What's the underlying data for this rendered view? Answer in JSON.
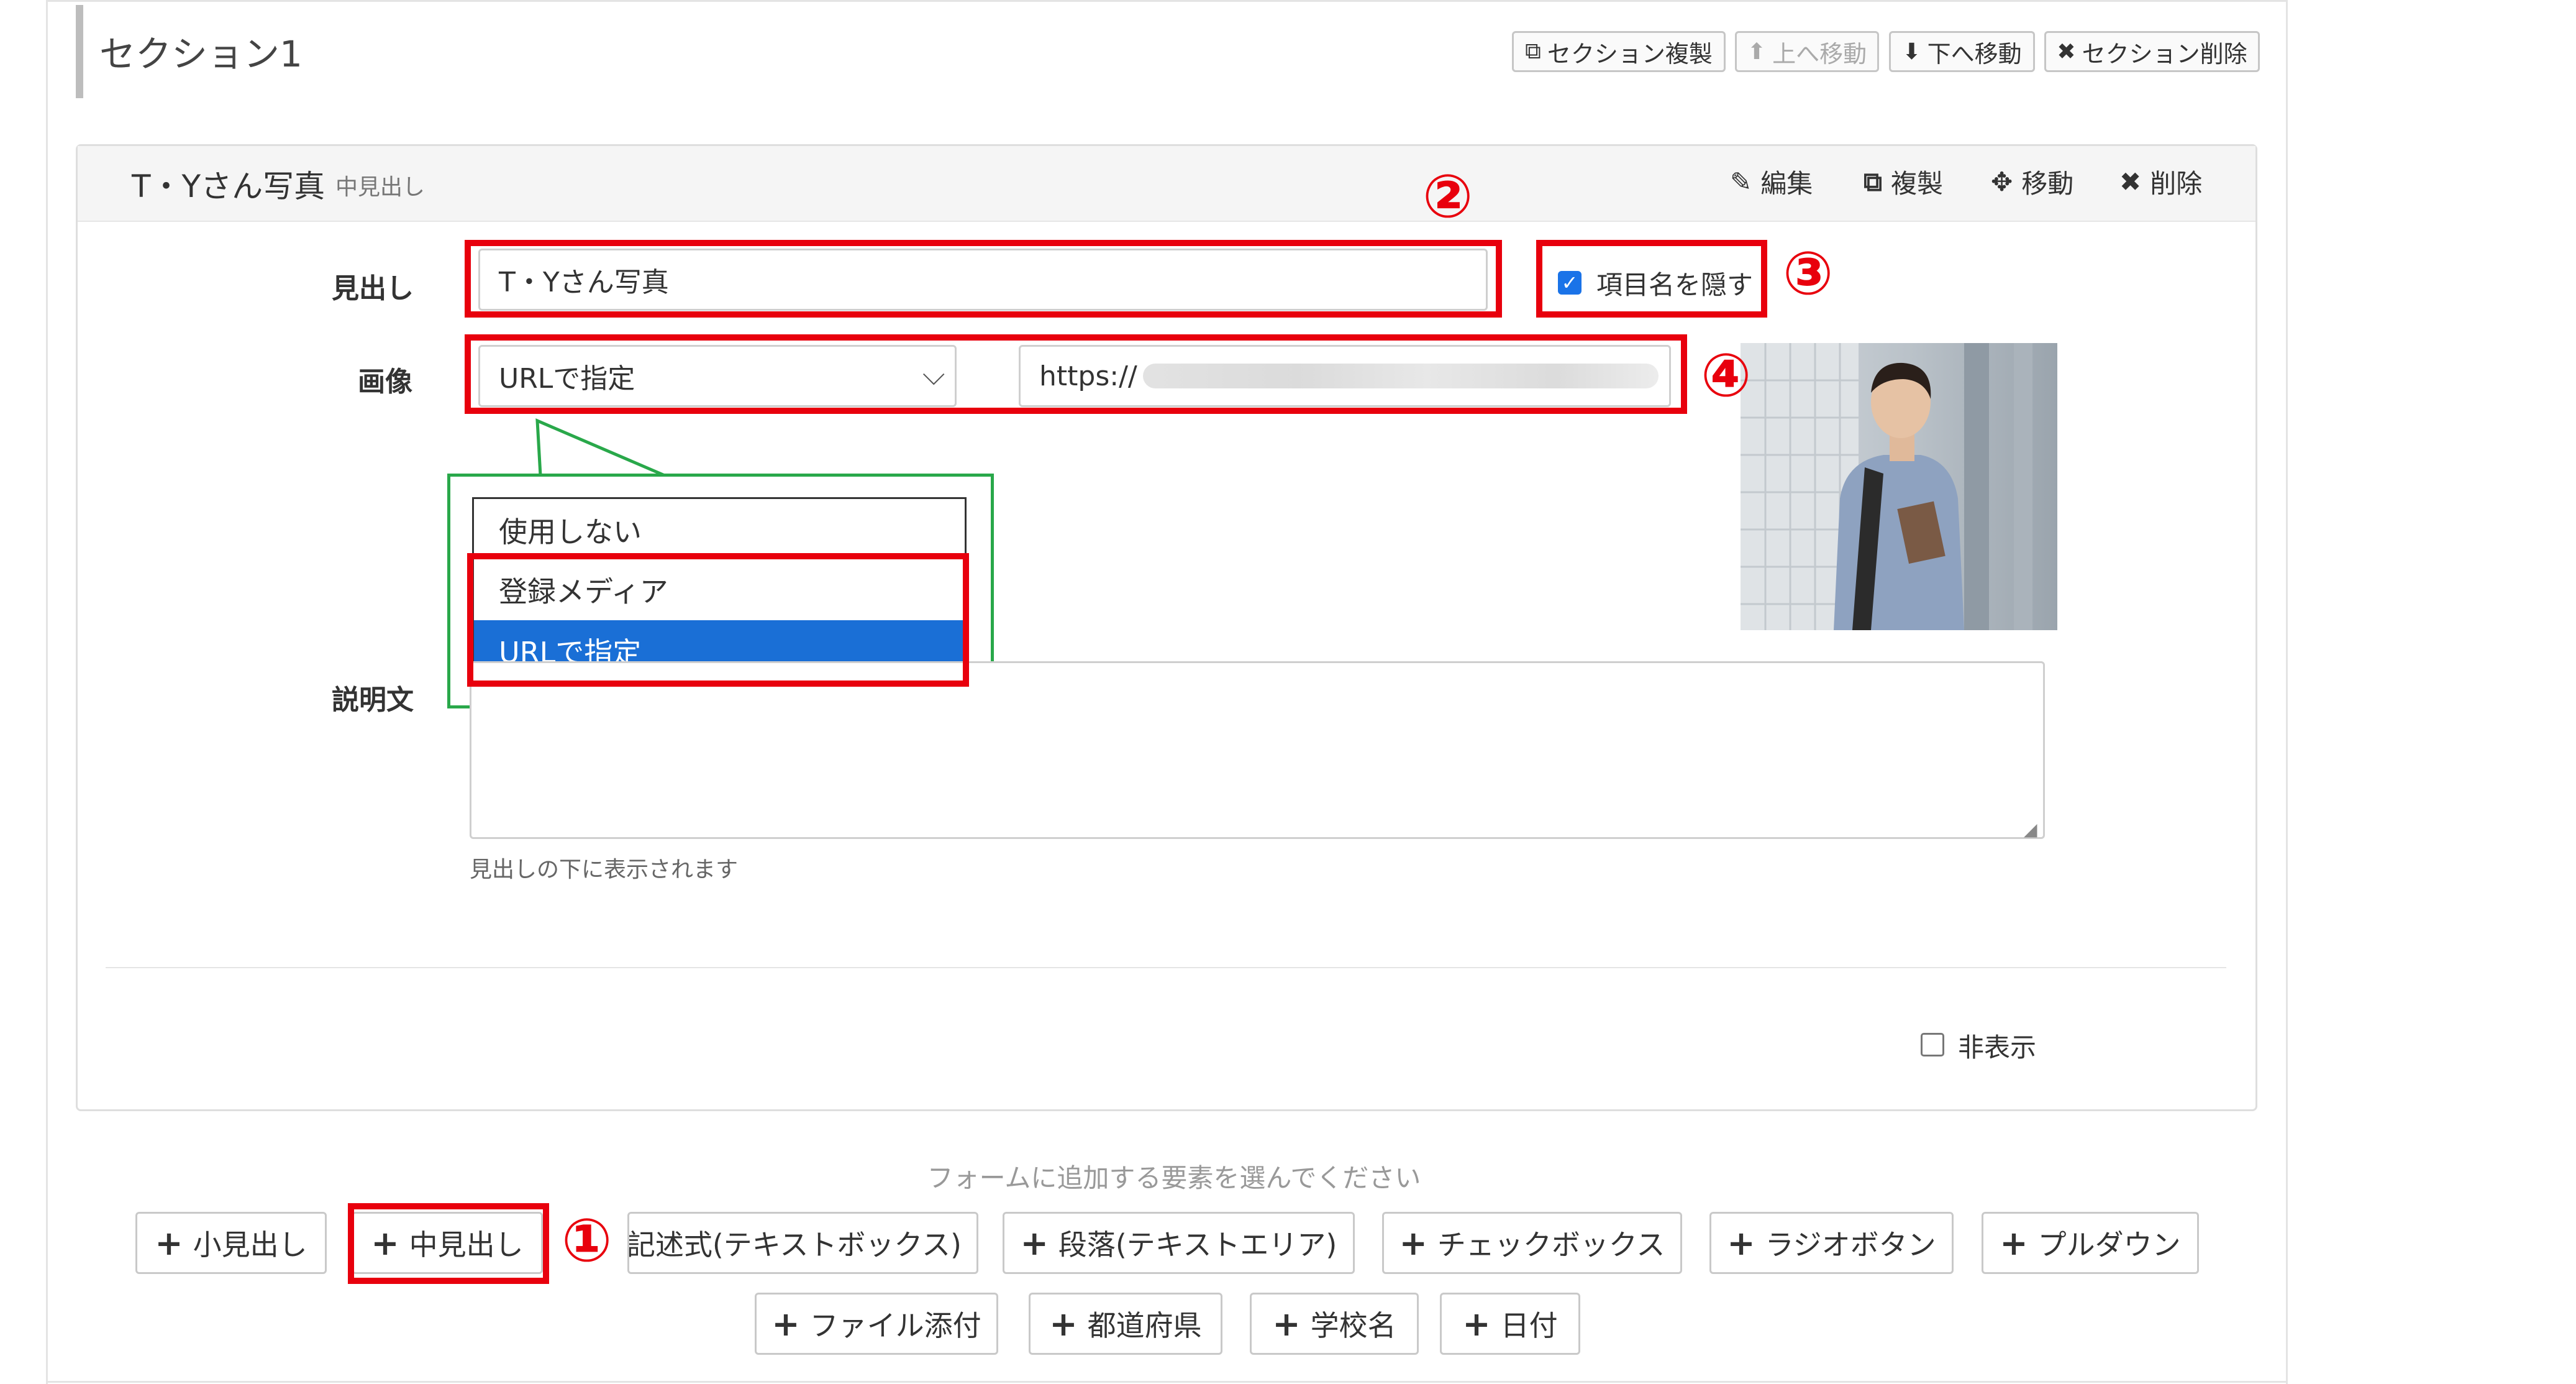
{
  "section": {
    "title": "セクション1",
    "buttons": [
      {
        "label": "セクション複製",
        "icon": "duplicate-icon",
        "disabled": false
      },
      {
        "label": "上へ移動",
        "icon": "arrow-up-icon",
        "disabled": true
      },
      {
        "label": "下へ移動",
        "icon": "arrow-down-icon",
        "disabled": false
      },
      {
        "label": "セクション削除",
        "icon": "close-icon",
        "disabled": false
      }
    ]
  },
  "field": {
    "name": "T・Yさん写真",
    "type": "中見出し",
    "actions": [
      {
        "label": "編集",
        "icon": "pencil-icon"
      },
      {
        "label": "複製",
        "icon": "duplicate-icon"
      },
      {
        "label": "移動",
        "icon": "move-icon"
      },
      {
        "label": "削除",
        "icon": "close-icon"
      }
    ],
    "heading_label": "見出し",
    "heading_value": "T・Yさん写真",
    "hide_name_label": "項目名を隠す",
    "hide_name_checked": true,
    "image_label": "画像",
    "image_select_value": "URLで指定",
    "image_url_value": "https://",
    "description_label": "説明文",
    "description_help": "見出しの下に表示されます",
    "hide_field_label": "非表示",
    "hide_field_checked": false
  },
  "dropdown_options": [
    {
      "label": "使用しない",
      "selected": false
    },
    {
      "label": "登録メディア",
      "selected": false
    },
    {
      "label": "URLで指定",
      "selected": true
    }
  ],
  "annotations": {
    "n1": "①",
    "n2": "②",
    "n3": "③",
    "n4": "④",
    "highlight_color": "#e8000d",
    "callout_color": "#29a84a"
  },
  "add_element": {
    "prompt": "フォームに追加する要素を選んでください",
    "buttons": [
      "小見出し",
      "中見出し",
      "記述式(テキストボックス)",
      "段落(テキストエリア)",
      "チェックボックス",
      "ラジオボタン",
      "プルダウン",
      "ファイル添付",
      "都道府県",
      "学校名",
      "日付"
    ]
  }
}
